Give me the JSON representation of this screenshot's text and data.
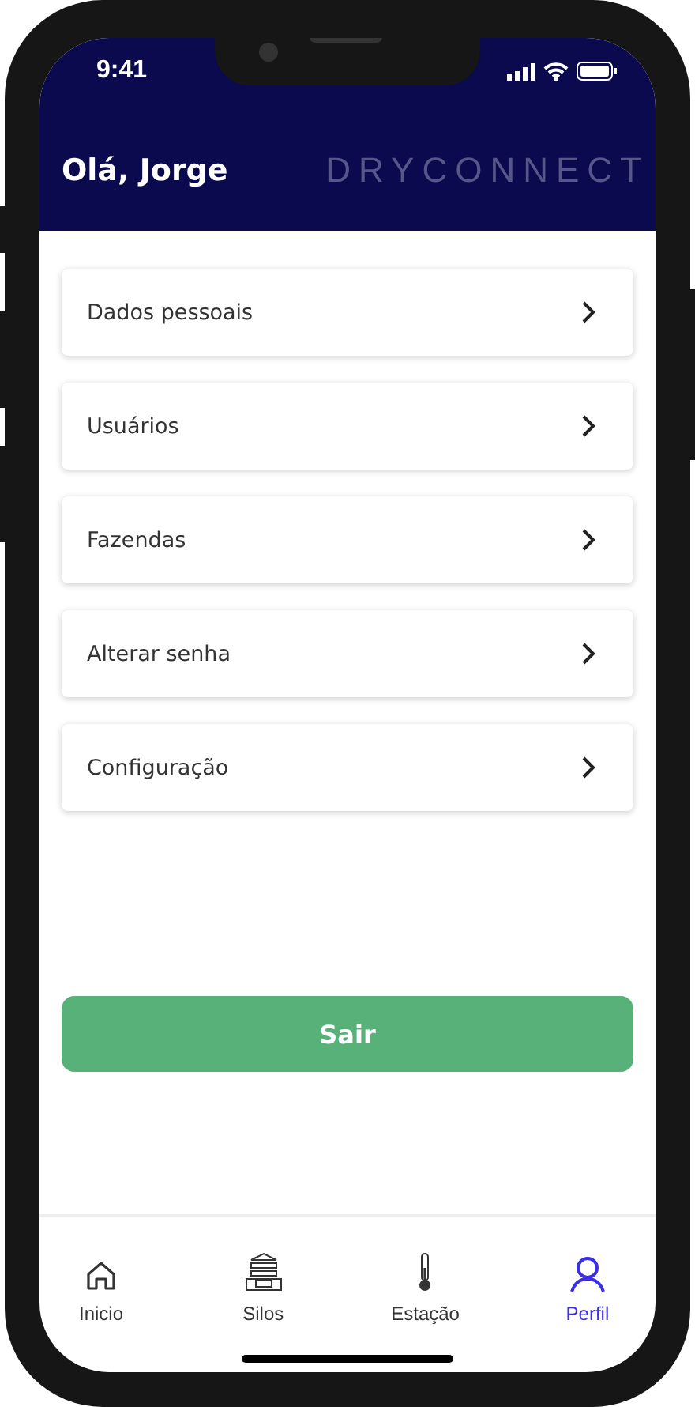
{
  "status_bar": {
    "time": "9:41"
  },
  "header": {
    "greeting": "Olá, Jorge",
    "logo": "DRYCONNECT"
  },
  "menu_items": [
    {
      "label": "Dados pessoais"
    },
    {
      "label": "Usuários"
    },
    {
      "label": "Fazendas"
    },
    {
      "label": "Alterar senha"
    },
    {
      "label": "Configuração"
    }
  ],
  "logout_button": "Sair",
  "tab_bar": [
    {
      "kind": "home",
      "label": "Inicio",
      "selected": false
    },
    {
      "kind": "silo",
      "label": "Silos",
      "selected": false
    },
    {
      "kind": "thermometer",
      "label": "Estação",
      "selected": false
    },
    {
      "kind": "person",
      "label": "Perfil",
      "selected": true
    }
  ]
}
